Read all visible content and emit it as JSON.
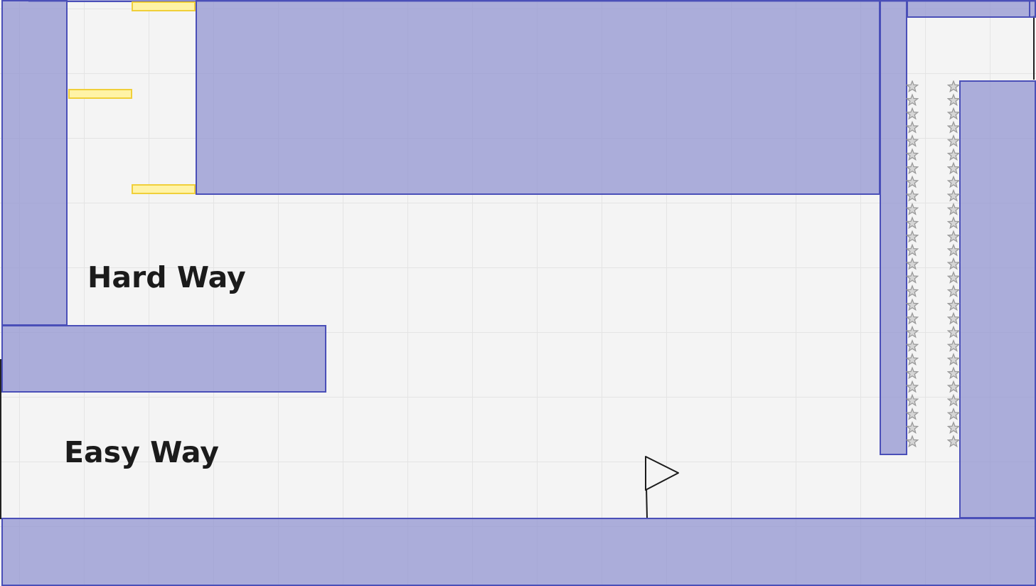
{
  "level": {
    "labels": {
      "hard_way": "Hard Way",
      "easy_way": "Easy Way"
    },
    "colors": {
      "background": "#f4f4f4",
      "grid": "#e4e4e4",
      "wall_fill": "#aaacd8",
      "wall_border": "#4a4fb8",
      "bounce_pad_fill": "#fff3a6",
      "bounce_pad_border": "#f0cf3a",
      "spike": "#9a9a9a",
      "flag_outline": "#1b1b1b"
    },
    "objects": {
      "bounce_pads": 3,
      "spike_columns": 2,
      "spikes_per_column": 27,
      "goal": "flag-icon",
      "hazard": "spike-icon"
    }
  }
}
